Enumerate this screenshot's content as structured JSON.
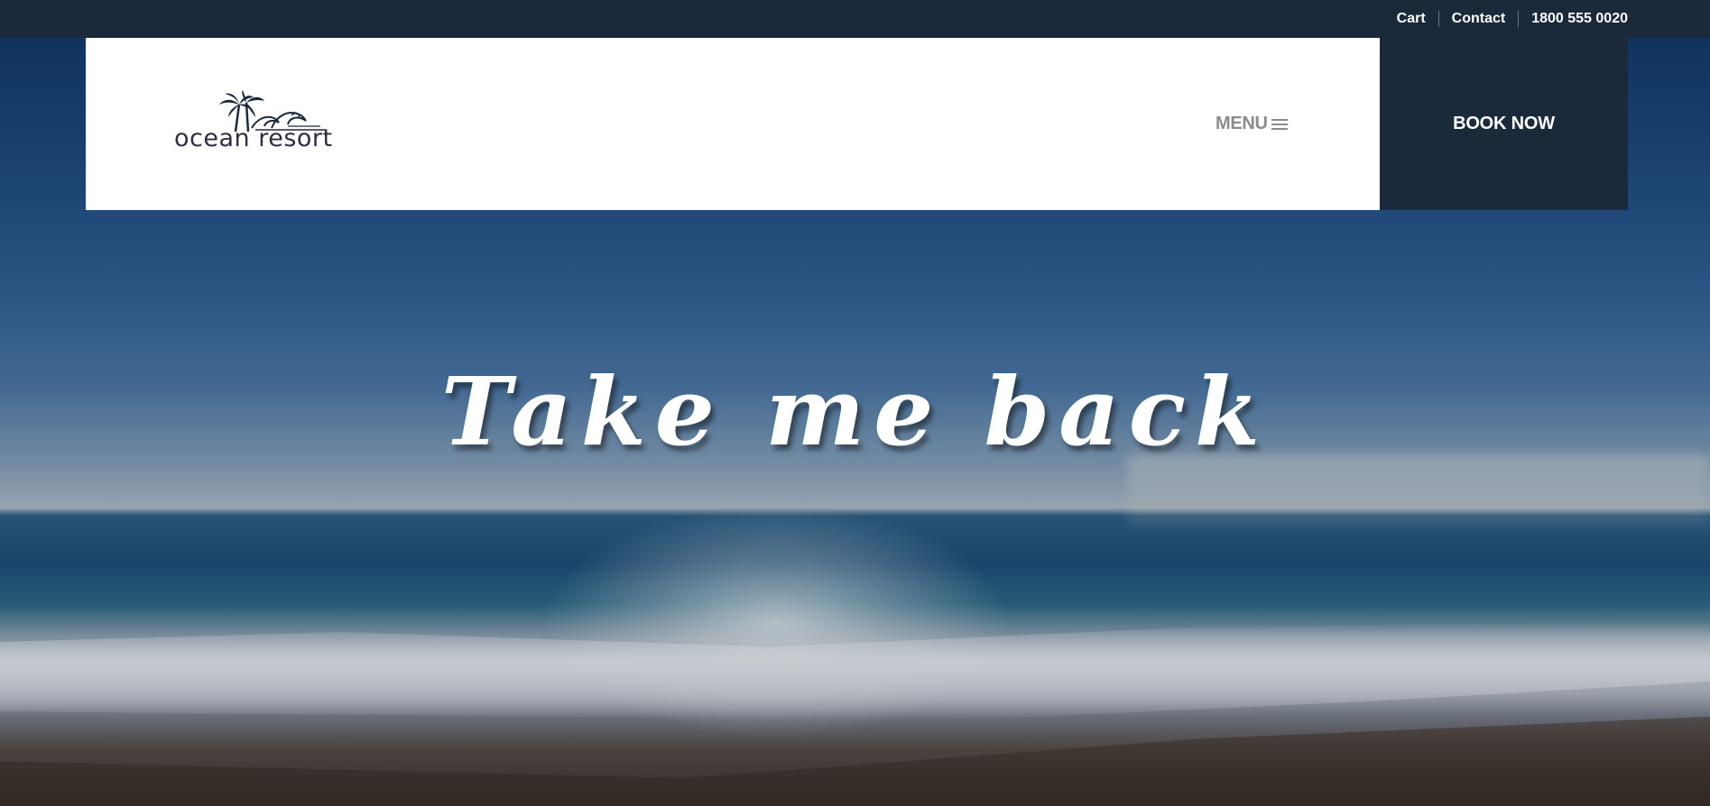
{
  "topbar": {
    "links": [
      {
        "label": "Cart"
      },
      {
        "label": "Contact"
      },
      {
        "label": "1800 555 0020"
      }
    ]
  },
  "header": {
    "logo_text": "ocean resort",
    "logo_icon": "palm-tree-wave-icon",
    "menu_label": "MENU",
    "menu_icon": "hamburger-icon",
    "book_label": "BOOK NOW"
  },
  "hero": {
    "headline": "Take me back"
  },
  "colors": {
    "dark_navy": "#1b2a3a",
    "menu_gray": "#8b8b8b",
    "white": "#ffffff"
  }
}
